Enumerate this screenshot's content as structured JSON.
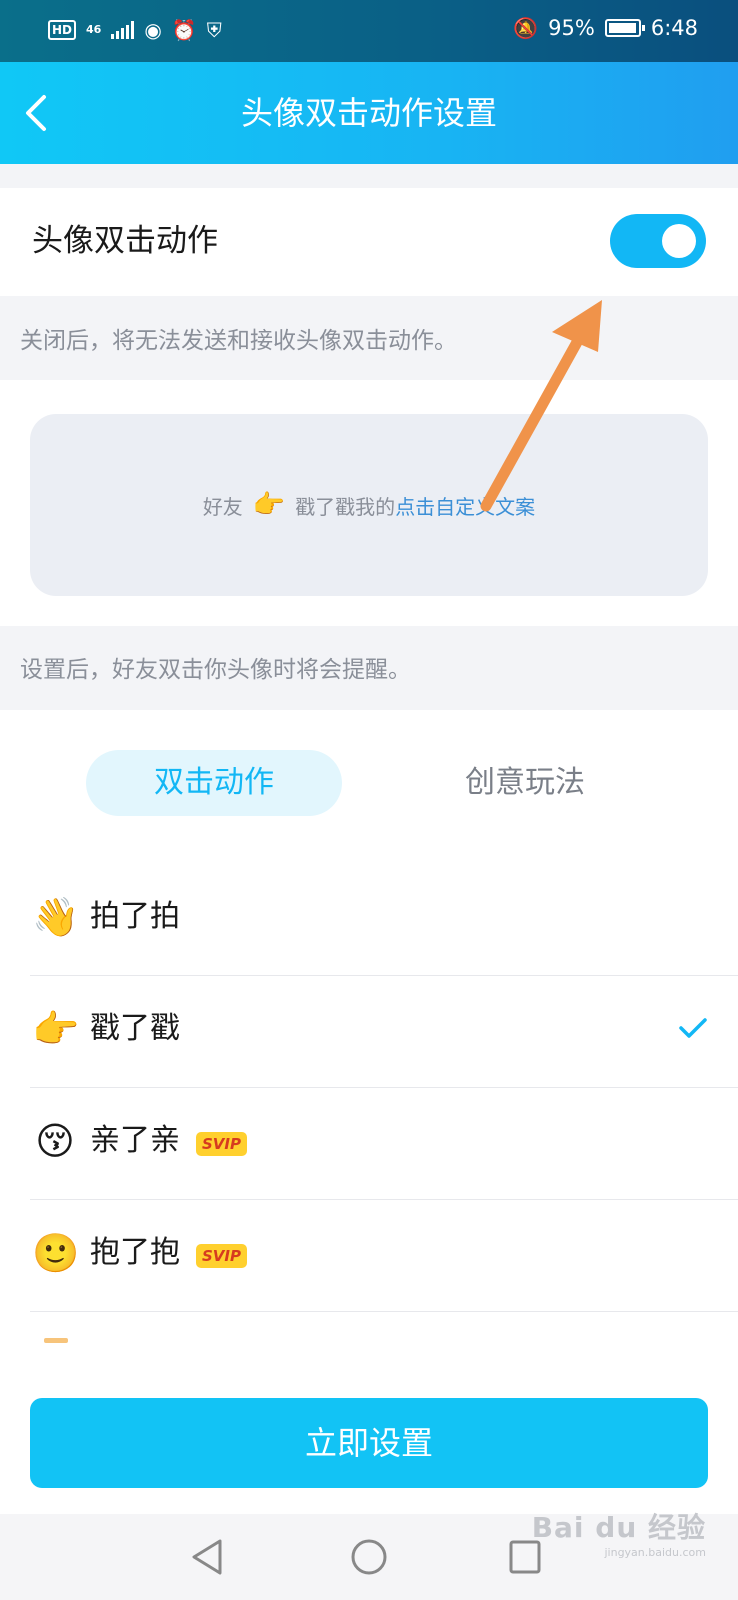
{
  "status_bar": {
    "hd": "HD",
    "network": "46",
    "battery_percent": "95%",
    "time": "6:48"
  },
  "nav": {
    "title": "头像双击动作设置"
  },
  "toggle_row": {
    "label": "头像双击动作",
    "enabled": true
  },
  "note_toggle": "关闭后，将无法发送和接收头像双击动作。",
  "preview": {
    "prefix": "好友",
    "emoji": "👉",
    "action_text": "戳了戳我的",
    "custom_link": "点击自定义文案"
  },
  "note_preview": "设置后，好友双击你头像时将会提醒。",
  "tabs": [
    {
      "label": "双击动作",
      "active": true
    },
    {
      "label": "创意玩法",
      "active": false
    }
  ],
  "actions": [
    {
      "icon": "👋",
      "label": "拍了拍",
      "svip": "",
      "selected": false
    },
    {
      "icon": "👉",
      "label": "戳了戳",
      "svip": "",
      "selected": true
    },
    {
      "icon": "😚",
      "label": "亲了亲",
      "svip": "SVIP",
      "selected": false
    },
    {
      "icon": "🙂",
      "label": "抱了抱",
      "svip": "SVIP",
      "selected": false
    }
  ],
  "cta_label": "立即设置",
  "watermark": {
    "brand": "Bai du 经验",
    "url": "jingyan.baidu.com"
  },
  "colors": {
    "accent": "#12b7f5",
    "nav_gradient_start": "#10c8f6",
    "annotation_arrow": "#f0934a",
    "svip_bg": "#ffd02e"
  }
}
